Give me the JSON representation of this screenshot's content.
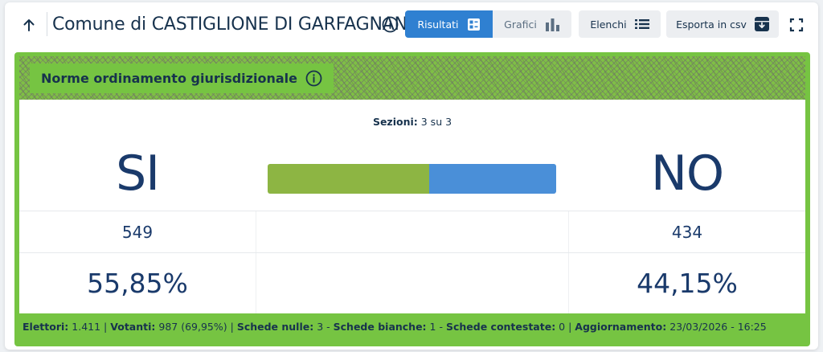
{
  "header": {
    "back_icon": "arrow-up-icon",
    "title": "Comune di CASTIGLIONE DI GARFAGNANA",
    "info_icon": "info-circle-icon",
    "buttons": {
      "risultati": "Risultati",
      "grafici": "Grafici",
      "elenchi": "Elenchi",
      "esporta": "Esporta in csv"
    },
    "active_tab": "Risultati",
    "fullscreen_icon": "fullscreen-icon"
  },
  "quesito": {
    "title": "Norme ordinamento giurisdizionale",
    "info_icon": "info-circle-icon"
  },
  "sezioni": {
    "label": "Sezioni:",
    "value": "3 su 3"
  },
  "results": {
    "si": {
      "label": "SI",
      "votes": "549",
      "percent": "55,85%",
      "share": 0.5585,
      "color": "#8db543"
    },
    "no": {
      "label": "NO",
      "votes": "434",
      "percent": "44,15%",
      "share": 0.4415,
      "color": "#4a8fd8"
    }
  },
  "footer": {
    "elettori_label": "Elettori:",
    "elettori_value": "1.411",
    "votanti_label": "Votanti:",
    "votanti_value": "987 (69,95%)",
    "nulle_label": "Schede nulle:",
    "nulle_value": "3",
    "bianche_label": "Schede bianche:",
    "bianche_value": "1",
    "contestate_label": "Schede contestate:",
    "contestate_value": "0",
    "aggiornamento_label": "Aggiornamento:",
    "aggiornamento_value": "23/03/2026 - 16:25"
  },
  "colors": {
    "accent_blue": "#2f80d1",
    "panel_green": "#76c442",
    "text_dark": "#17324d"
  }
}
